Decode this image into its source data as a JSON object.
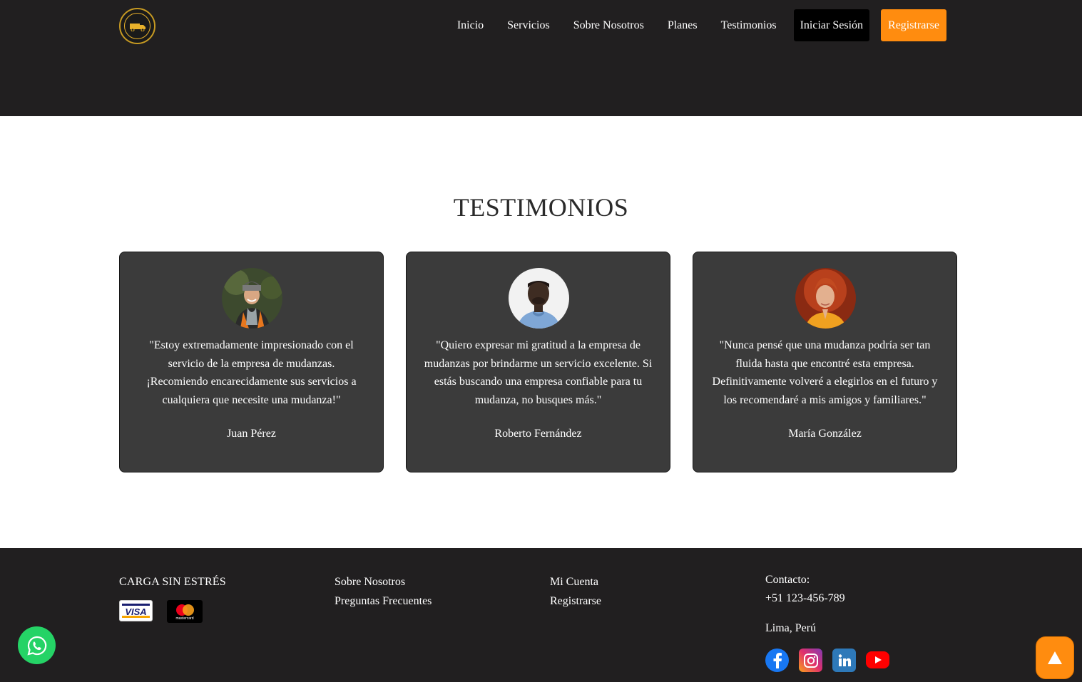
{
  "header": {
    "logo_icon": "company-logo",
    "nav": [
      {
        "label": "Inicio"
      },
      {
        "label": "Servicios"
      },
      {
        "label": "Sobre Nosotros"
      },
      {
        "label": "Planes"
      },
      {
        "label": "Testimonios"
      }
    ],
    "login_label": "Iniciar Sesión",
    "register_label": "Registrarse",
    "colors": {
      "background": "#211f20",
      "login_bg": "#000000",
      "register_bg": "#ff8c0f"
    }
  },
  "testimonials": {
    "title": "TESTIMONIOS",
    "items": [
      {
        "quote": "\"Estoy extremadamente impresionado con el servicio de la empresa de mudanzas. ¡Recomiendo encarecidamente sus servicios a cualquiera que necesite una mudanza!\"",
        "author": "Juan Pérez",
        "avatar": "man-with-beanie-photo"
      },
      {
        "quote": "\"Quiero expresar mi gratitud a la empresa de mudanzas por brindarme un servicio excelente. Si estás buscando una empresa confiable para tu mudanza, no busques más.\"",
        "author": "Roberto Fernández",
        "avatar": "man-blue-shirt-photo"
      },
      {
        "quote": "\"Nunca pensé que una mudanza podría ser tan fluida hasta que encontré esta empresa. Definitivamente volveré a elegirlos en el futuro y los recomendaré a mis amigos y familiares.\"",
        "author": "María González",
        "avatar": "woman-red-hair-photo"
      }
    ],
    "colors": {
      "card_bg": "#3b3b3b"
    }
  },
  "footer": {
    "brand": "CARGA SIN ESTRÉS",
    "payment_icons": [
      "visa-icon",
      "mastercard-icon"
    ],
    "visa_text": "VISA",
    "mastercard_text": "mastercard",
    "col2": [
      "Sobre Nosotros",
      "Preguntas Frecuentes"
    ],
    "col3": [
      "Mi Cuenta",
      "Registrarse"
    ],
    "contact": {
      "label": "Contacto:",
      "phone": "+51 123-456-789",
      "city": "Lima, Perú"
    },
    "socials": [
      "facebook-icon",
      "instagram-icon",
      "linkedin-icon",
      "youtube-icon"
    ]
  },
  "floating": {
    "whatsapp_icon": "whatsapp-icon",
    "to_top_icon": "arrow-up-icon",
    "colors": {
      "whatsapp": "#25d366",
      "to_top": "#ff8c0f"
    }
  }
}
